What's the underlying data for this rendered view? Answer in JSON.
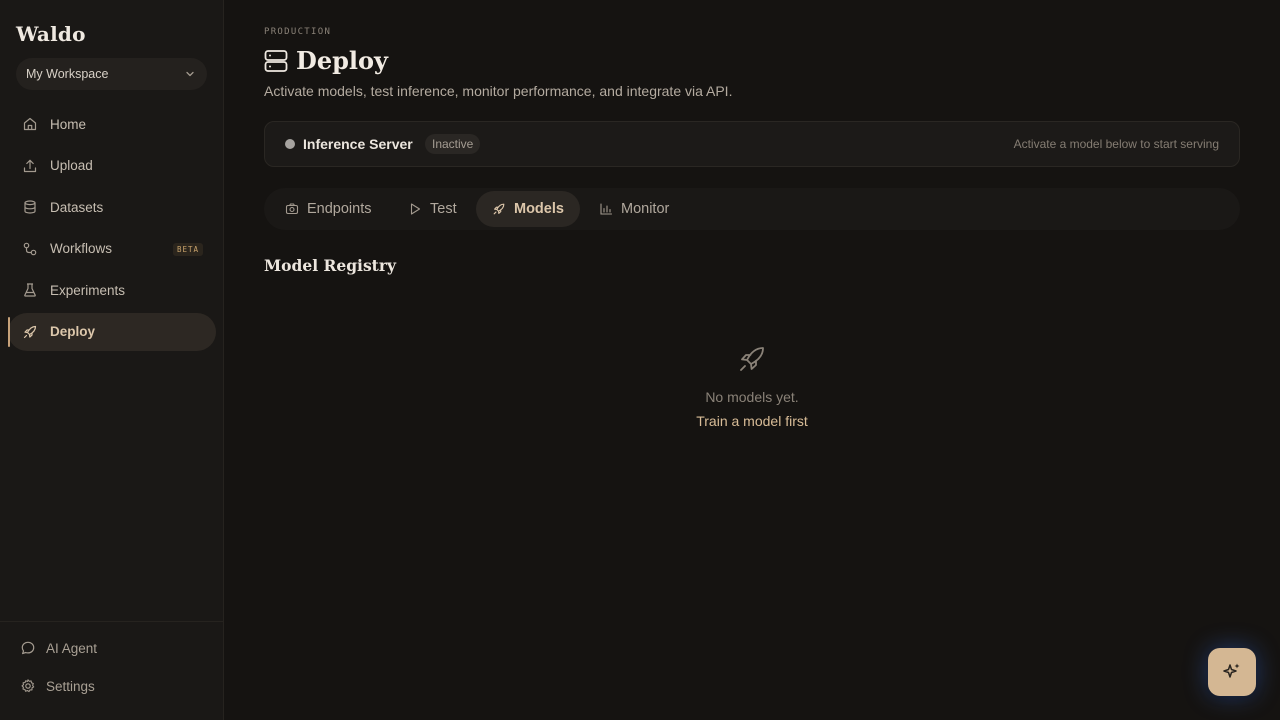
{
  "app": {
    "name": "Waldo"
  },
  "workspace": {
    "label": "My Workspace"
  },
  "sidebar": {
    "items": [
      {
        "label": "Home",
        "icon": "home-icon",
        "active": false
      },
      {
        "label": "Upload",
        "icon": "upload-icon",
        "active": false
      },
      {
        "label": "Datasets",
        "icon": "database-icon",
        "active": false
      },
      {
        "label": "Workflows",
        "icon": "workflow-icon",
        "active": false,
        "badge": "BETA"
      },
      {
        "label": "Experiments",
        "icon": "flask-icon",
        "active": false
      },
      {
        "label": "Deploy",
        "icon": "rocket-icon",
        "active": true
      }
    ],
    "bottom": [
      {
        "label": "AI Agent",
        "icon": "chat-icon"
      },
      {
        "label": "Settings",
        "icon": "gear-icon"
      }
    ]
  },
  "page": {
    "eyebrow": "PRODUCTION",
    "title": "Deploy",
    "subtitle": "Activate models, test inference, monitor performance, and integrate via API."
  },
  "server": {
    "name": "Inference Server",
    "status": "Inactive",
    "hint": "Activate a model below to start serving"
  },
  "tabs": [
    {
      "label": "Endpoints",
      "icon": "camera-icon",
      "active": false
    },
    {
      "label": "Test",
      "icon": "play-icon",
      "active": false
    },
    {
      "label": "Models",
      "icon": "rocket-icon",
      "active": true
    },
    {
      "label": "Monitor",
      "icon": "bar-chart-icon",
      "active": false
    }
  ],
  "registry": {
    "title": "Model Registry",
    "empty_text": "No models yet.",
    "empty_link": "Train a model first"
  },
  "colors": {
    "accent": "#d4b793",
    "background": "#151311",
    "sidebar": "#1a1816"
  }
}
